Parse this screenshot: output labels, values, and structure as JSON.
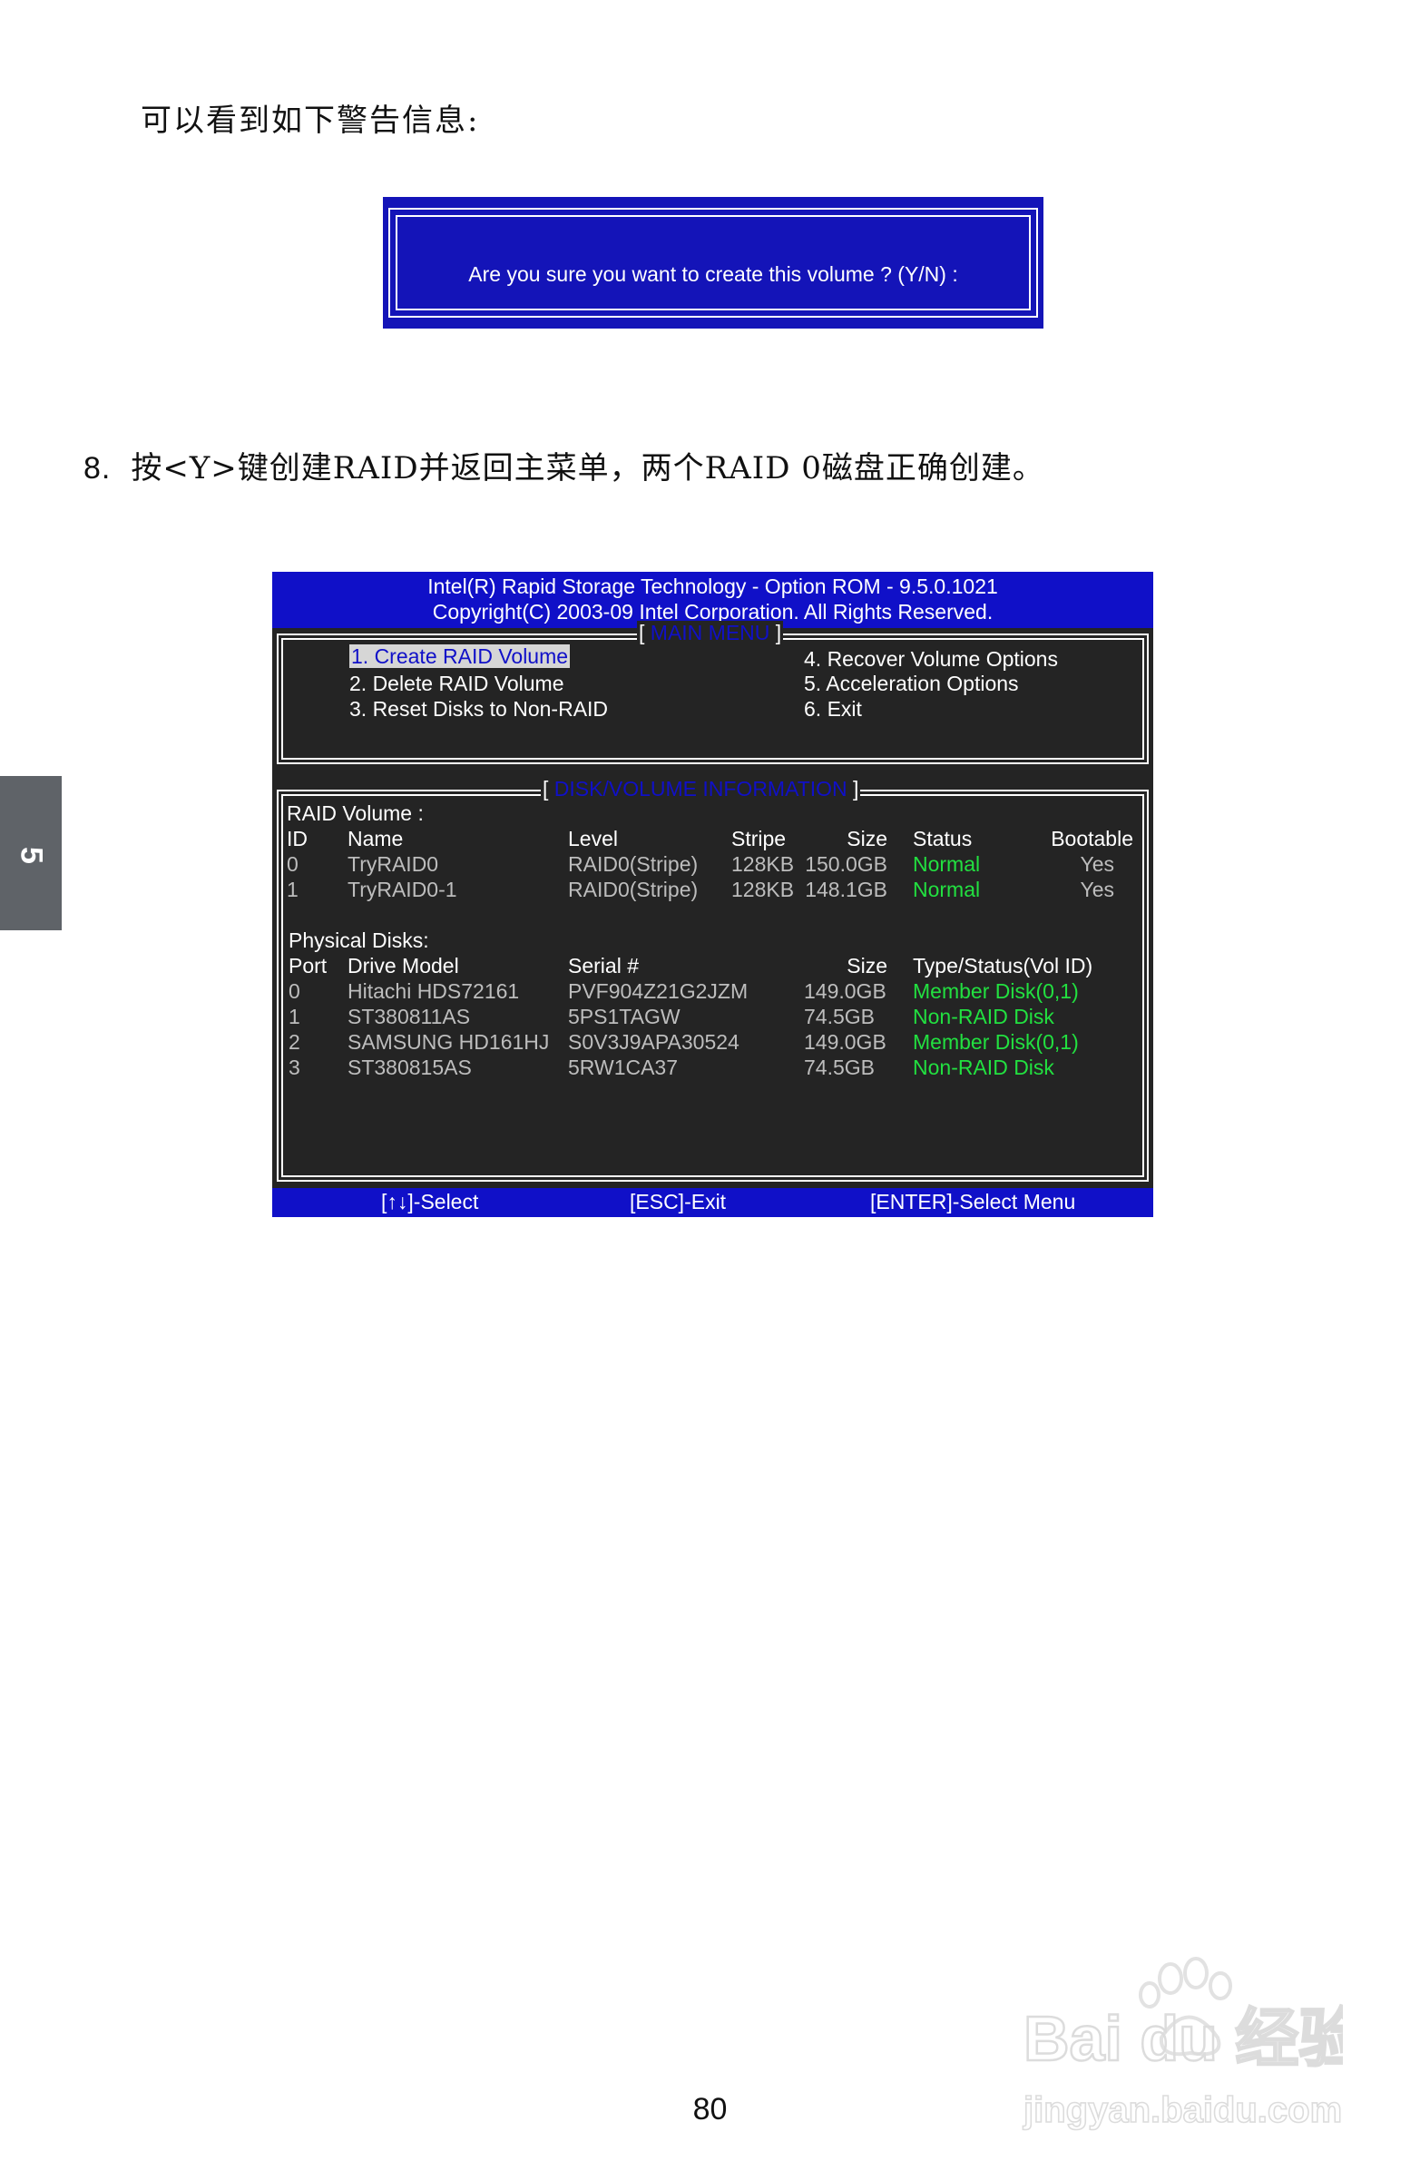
{
  "intro_text": "可以看到如下警告信息:",
  "dialog": {
    "question": "Are you sure you want to create this volume ? (Y/N) :"
  },
  "step": {
    "number": "8.",
    "text": "按<Y>键创建RAID并返回主菜单，两个RAID 0磁盘正确创建。"
  },
  "side_tab": "5",
  "bios": {
    "header_line1": "Intel(R) Rapid Storage Technology - Option ROM - 9.5.0.1021",
    "header_line2": "Copyright(C) 2003-09 Intel Corporation.   All Rights Reserved.",
    "main_menu_title": "MAIN MENU",
    "menu": {
      "left": [
        "1. Create RAID Volume",
        "2. Delete RAID Volume",
        "3. Reset Disks to Non-RAID"
      ],
      "right": [
        "4. Recover Volume Options",
        "5. Acceleration Options",
        "6. Exit"
      ]
    },
    "info_title": "DISK/VOLUME INFORMATION",
    "raid_volume_label": "RAID Volume :",
    "volume_headers": [
      "ID",
      "Name",
      "Level",
      "Stripe",
      "Size",
      "Status",
      "Bootable"
    ],
    "volumes": [
      [
        "0",
        "TryRAID0",
        "RAID0(Stripe)",
        "128KB",
        "150.0GB",
        "Normal",
        "Yes"
      ],
      [
        "1",
        "TryRAID0-1",
        "RAID0(Stripe)",
        "128KB",
        "148.1GB",
        "Normal",
        "Yes"
      ]
    ],
    "physical_label": "Physical Disks:",
    "disk_headers": [
      "Port",
      "Drive Model",
      "Serial #",
      "Size",
      "Type/Status(Vol ID)"
    ],
    "disks": [
      [
        "0",
        "Hitachi HDS72161",
        "PVF904Z21G2JZM",
        "149.0GB",
        "Member Disk(0,1)"
      ],
      [
        "1",
        "ST380811AS",
        "5PS1TAGW",
        "74.5GB",
        "Non-RAID Disk"
      ],
      [
        "2",
        "SAMSUNG HD161HJ",
        "S0V3J9APA30524",
        "149.0GB",
        "Member Disk(0,1)"
      ],
      [
        "3",
        "ST380815AS",
        "5RW1CA37",
        "74.5GB",
        "Non-RAID Disk"
      ]
    ],
    "footer": [
      "[↑↓]-Select",
      "[ESC]-Exit",
      "[ENTER]-Select Menu"
    ]
  },
  "page_number": "80",
  "watermark": {
    "brand": "Bai du 经验",
    "url": "jingyan.baidu.com"
  }
}
